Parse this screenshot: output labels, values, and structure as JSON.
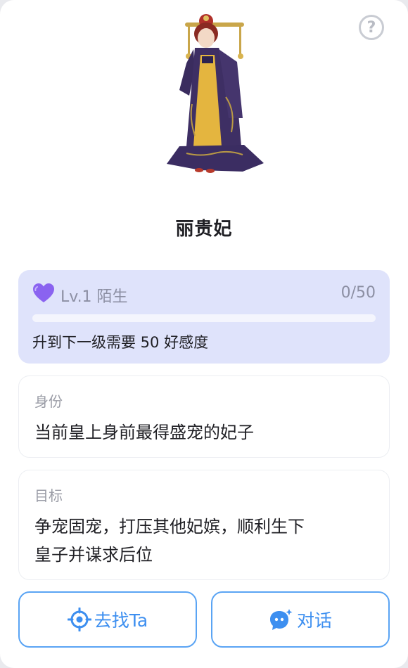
{
  "help": {
    "icon": "question-icon",
    "symbol": "?"
  },
  "character": {
    "name": "丽贵妃",
    "portrait": "consort-portrait"
  },
  "affinity": {
    "icon": "heart-icon",
    "level_label": "Lv.1 陌生",
    "count": "0/50",
    "progress": 0,
    "hint": "升到下一级需要 50 好感度",
    "colors": {
      "panel": "#dfe3fb",
      "heart": "#8a63f0"
    }
  },
  "identity": {
    "title": "身份",
    "text": "当前皇上身前最得盛宠的妃子"
  },
  "goal": {
    "title": "目标",
    "line1": "争宠固宠，打压其他妃嫔，顺利生下",
    "line2": "皇子并谋求后位"
  },
  "actions": {
    "find": {
      "label": "去找Ta",
      "icon": "locate-icon"
    },
    "chat": {
      "label": "对话",
      "icon": "chat-bubble-icon"
    },
    "accent": "#3d8ff0"
  }
}
